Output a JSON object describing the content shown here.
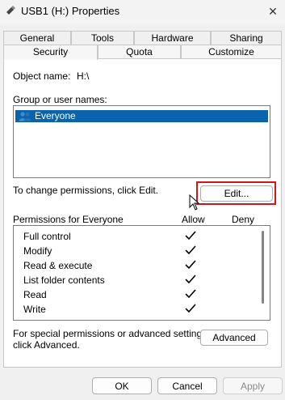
{
  "window": {
    "title": "USB1 (H:) Properties",
    "close_glyph": "✕"
  },
  "tabs": {
    "back_row": [
      "General",
      "Tools",
      "Hardware",
      "Sharing"
    ],
    "front_row": [
      "Security",
      "Quota",
      "Customize"
    ],
    "selected": "Security"
  },
  "security": {
    "object_name_label": "Object name:",
    "object_name_value": "H:\\",
    "group_label": "Group or user names:",
    "users": [
      "Everyone"
    ],
    "change_hint": "To change permissions, click Edit.",
    "edit_button": "Edit...",
    "permissions_header": "Permissions for Everyone",
    "allow_header": "Allow",
    "deny_header": "Deny",
    "permissions": [
      {
        "name": "Full control",
        "allow": true,
        "deny": false
      },
      {
        "name": "Modify",
        "allow": true,
        "deny": false
      },
      {
        "name": "Read & execute",
        "allow": true,
        "deny": false
      },
      {
        "name": "List folder contents",
        "allow": true,
        "deny": false
      },
      {
        "name": "Read",
        "allow": true,
        "deny": false
      },
      {
        "name": "Write",
        "allow": true,
        "deny": false
      }
    ],
    "advanced_hint_line1": "For special permissions or advanced settings,",
    "advanced_hint_line2": "click Advanced.",
    "advanced_button": "Advanced"
  },
  "footer": {
    "ok": "OK",
    "cancel": "Cancel",
    "apply": "Apply"
  },
  "colors": {
    "selection": "#0a64ad",
    "highlight_box": "#d0161b"
  }
}
